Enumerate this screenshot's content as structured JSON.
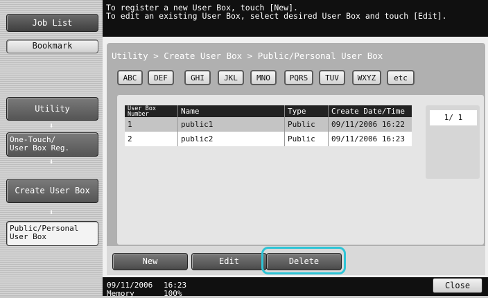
{
  "sidebar": {
    "job_list": "Job List",
    "bookmark": "Bookmark",
    "flow": {
      "utility": "Utility",
      "one_touch_line1": "One-Touch/",
      "one_touch_line2": "User Box Reg.",
      "create_user_box": "Create User Box",
      "public_personal_line1": "Public/Personal",
      "public_personal_line2": "User Box",
      "arrow": "⬇"
    }
  },
  "message": {
    "line1": "To register a new User Box, touch [New].",
    "line2": "To edit an existing User Box, select desired User Box and touch [Edit]."
  },
  "breadcrumb": "Utility > Create User Box > Public/Personal User Box",
  "index_buttons": [
    "ABC",
    "DEF",
    "GHI",
    "JKL",
    "MNO",
    "PQRS",
    "TUV",
    "WXYZ",
    "etc"
  ],
  "table": {
    "headers": {
      "number_line1": "User Box",
      "number_line2": "Number",
      "name": "Name",
      "type": "Type",
      "date": "Create Date/Time"
    },
    "rows": [
      {
        "number": "1",
        "name": "public1",
        "type": "Public",
        "date": "09/11/2006 16:22"
      },
      {
        "number": "2",
        "name": "public2",
        "type": "Public",
        "date": "09/11/2006 16:23"
      }
    ]
  },
  "pager": "1/ 1",
  "actions": {
    "new": "New",
    "edit": "Edit",
    "delete": "Delete"
  },
  "status": {
    "date": "09/11/2006",
    "time": "16:23",
    "memory_label": "Memory",
    "memory_value": "100%",
    "close": "Close"
  },
  "colors": {
    "highlight": "#2ec4d6"
  }
}
